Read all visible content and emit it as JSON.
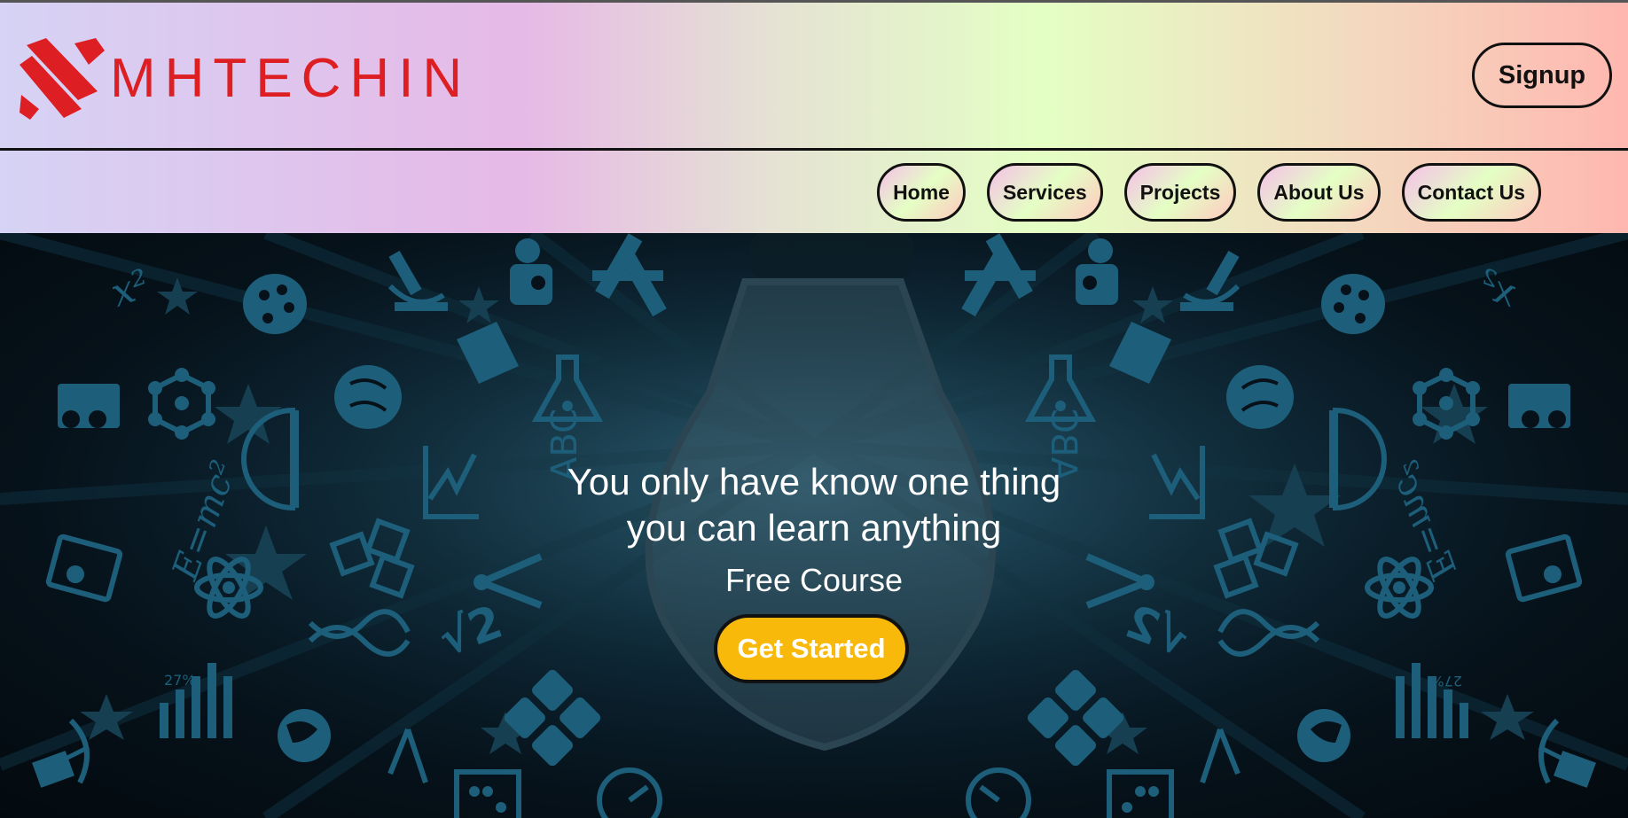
{
  "brand": {
    "logo_text": "MHTECHIN",
    "color": "#dd1f24"
  },
  "header": {
    "signup_label": "Signup"
  },
  "nav": {
    "items": [
      "Home",
      "Services",
      "Projects",
      "About Us",
      "Contact Us"
    ]
  },
  "hero": {
    "headline_line1": "You only have know one thing",
    "headline_line2": "you can learn anything",
    "subheadline": "Free Course",
    "cta_label": "Get Started",
    "cta_color": "#f8b90a",
    "icon_text": {
      "left_percent": "27%",
      "right_percent": "27%"
    }
  },
  "icons": [
    "x-squared-icon",
    "palette-icon",
    "microscope-icon",
    "scientist-icon",
    "swords-icon",
    "flask-icon",
    "brain-icon",
    "abc-icon",
    "molecule-icon",
    "classroom-icon",
    "protractor-icon",
    "graph-icon",
    "emc2-icon",
    "blocks-icon",
    "atom-icon",
    "compass-icon",
    "presentation-icon",
    "dna-icon",
    "sqrt2-icon",
    "calculator-icon",
    "bar-chart-icon",
    "globe-icon",
    "telescope-icon",
    "abacus-icon",
    "clock-icon"
  ]
}
